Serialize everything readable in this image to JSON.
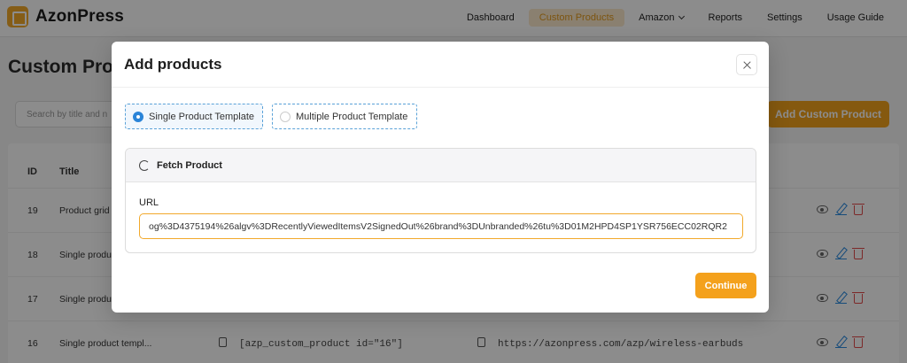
{
  "app": {
    "name": "AzonPress"
  },
  "nav": {
    "items": [
      {
        "label": "Dashboard"
      },
      {
        "label": "Custom Products"
      },
      {
        "label": "Amazon"
      },
      {
        "label": "Reports"
      },
      {
        "label": "Settings"
      },
      {
        "label": "Usage Guide"
      }
    ],
    "active": "Custom Products"
  },
  "page": {
    "title": "Custom Prod",
    "search_placeholder": "Search by title and n",
    "add_button": "Add Custom Product"
  },
  "table": {
    "headers": [
      "ID",
      "Title"
    ],
    "rows": [
      {
        "id": "19",
        "title": "Product grid",
        "code": "",
        "url": ""
      },
      {
        "id": "18",
        "title": "Single produ",
        "code": "",
        "url": ""
      },
      {
        "id": "17",
        "title": "Single produ",
        "code": "",
        "url": ""
      },
      {
        "id": "16",
        "title": "Single product templ...",
        "code": "[azp_custom_product id=\"16\"]",
        "url": "https://azonpress.com/azp/wireless-earbuds"
      }
    ]
  },
  "modal": {
    "title": "Add products",
    "templates": [
      {
        "label": "Single Product Template",
        "selected": true
      },
      {
        "label": "Multiple Product Template",
        "selected": false
      }
    ],
    "fetch_title": "Fetch Product",
    "url_label": "URL",
    "url_value": "og%3D4375194%26algv%3DRecentlyViewedItemsV2SignedOut%26brand%3DUnbranded%26tu%3D01M2HPD4SP1YSR756ECC02RQR2",
    "continue_button": "Continue"
  },
  "colors": {
    "accent": "#f4a11c",
    "radio_selected": "#2a84d8",
    "edit_icon": "#2a8ae0",
    "delete_icon": "#e24a4a"
  }
}
